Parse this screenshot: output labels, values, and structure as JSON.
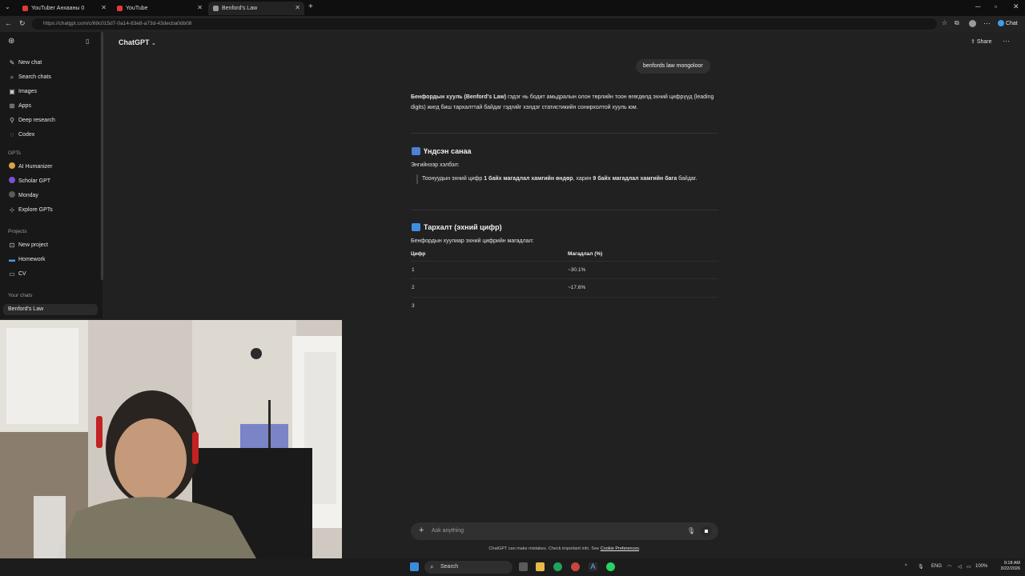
{
  "browser": {
    "tabs": [
      {
        "label": "YouTuber Анхааны 0",
        "active": false
      },
      {
        "label": "YouTube",
        "active": false
      },
      {
        "label": "Benford's Law",
        "active": true
      }
    ],
    "url": "https://chatgpt.com/c/69c015d7-0a14-83e8-a73d-43decba0db08",
    "right_button": "Chat"
  },
  "sidebar": {
    "items": [
      {
        "label": "New chat",
        "icon": "pencil-icon"
      },
      {
        "label": "Search chats",
        "icon": "search-icon"
      },
      {
        "label": "Images",
        "icon": "image-icon"
      },
      {
        "label": "Apps",
        "icon": "apps-icon"
      },
      {
        "label": "Deep research",
        "icon": "research-icon"
      },
      {
        "label": "Codex",
        "icon": "codex-icon"
      }
    ],
    "gpts_heading": "GPTs",
    "gpts": [
      {
        "label": "AI Humanizer",
        "color": "#d9a441"
      },
      {
        "label": "Scholar GPT",
        "color": "#7b4fd6"
      },
      {
        "label": "Monday",
        "color": "#5a5a5a"
      },
      {
        "label": "Explore GPTs",
        "color": ""
      }
    ],
    "projects_heading": "Projects",
    "projects": [
      {
        "label": "New project"
      },
      {
        "label": "Homework",
        "color": "#4a9ce8"
      },
      {
        "label": "CV"
      }
    ],
    "chats_heading": "Your chats",
    "chats": [
      {
        "label": "Benford's Law"
      }
    ]
  },
  "header": {
    "title": "ChatGPT",
    "share": "Share"
  },
  "chat": {
    "user_message": "benfords law mongoloor",
    "intro_bold": "Бенфордын хууль (Benford's Law)",
    "intro_rest": " гэдэг нь бодит амьдралын олон төрлийн тоон өгөгдөлд эхний цифрүүд (leading digits) жигд биш тархалттай байдаг гэдгийг хэлдэг статистикийн сонирхолтой хууль юм.",
    "section1_title": "Үндсэн санаа",
    "section1_sub": "Энгийнээр хэлбэл:",
    "quote_pre": "Тоонуудын эхний цифр ",
    "quote_bold1": "1 байх магадлал хамгийн өндөр",
    "quote_mid": ", харин ",
    "quote_bold2": "9 байх магадлал хамгийн бага",
    "quote_post": " байдаг.",
    "section2_title": "Тархалт (эхний цифр)",
    "section2_sub": "Бенфордын хуулиар эхний цифрийн магадлал:",
    "table": {
      "headers": [
        "Цифр",
        "Магадлал (%)"
      ],
      "rows": [
        [
          "1",
          "~30.1%"
        ],
        [
          "2",
          "~17.6%"
        ],
        [
          "3",
          ""
        ]
      ]
    }
  },
  "composer": {
    "placeholder": "Ask anything",
    "disclaimer_text": "ChatGPT can make mistakes. Check important info. See ",
    "disclaimer_link": "Cookie Preferences",
    "disclaimer_end": "."
  },
  "taskbar": {
    "search": "Search",
    "lang": "ENG",
    "battery": "100%",
    "time": "9:18 AM",
    "date": "3/22/2026"
  }
}
